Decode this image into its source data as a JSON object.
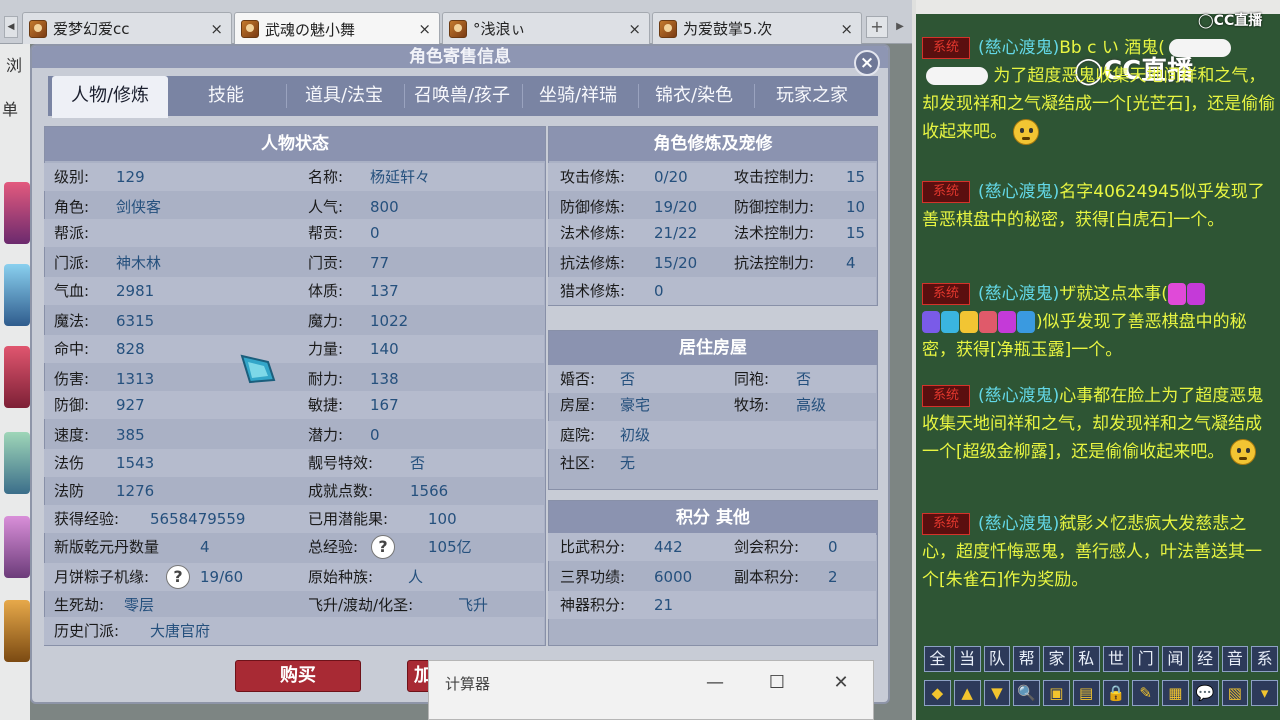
{
  "browser": {
    "tabs": [
      {
        "title": "爱梦幻爱cc",
        "close": "×"
      },
      {
        "title": "武魂の魅小舞",
        "close": "×"
      },
      {
        "title": "°浅浪ぃ",
        "close": "×"
      },
      {
        "title": "为爱鼓掌5.次",
        "close": "×"
      }
    ],
    "new_tab": "+",
    "left_text_1": "浏",
    "left_text_2": "单"
  },
  "dialog": {
    "title": "角色寄售信息",
    "close": "×",
    "tabs": [
      "人物/修炼",
      "技能",
      "道具/法宝",
      "召唤兽/孩子",
      "坐骑/祥瑞",
      "锦衣/染色",
      "玩家之家"
    ],
    "status": {
      "header": "人物状态",
      "left": [
        {
          "label": "级别:",
          "value": "129"
        },
        {
          "label": "角色:",
          "value": "剑侠客"
        },
        {
          "label": "帮派:",
          "value": ""
        },
        {
          "label": "门派:",
          "value": "神木林"
        },
        {
          "label": "气血:",
          "value": "2981"
        },
        {
          "label": "魔法:",
          "value": "6315"
        },
        {
          "label": "命中:",
          "value": "828"
        },
        {
          "label": "伤害:",
          "value": "1313"
        },
        {
          "label": "防御:",
          "value": "927"
        },
        {
          "label": "速度:",
          "value": "385"
        },
        {
          "label": "法伤",
          "value": "1543"
        },
        {
          "label": "法防",
          "value": "1276"
        },
        {
          "label": "获得经验:",
          "value": "5658479559"
        },
        {
          "label": "新版乾元丹数量",
          "value": "4"
        },
        {
          "label": "月饼粽子机缘:",
          "value": "19/60"
        },
        {
          "label": "生死劫:",
          "value": "零层"
        },
        {
          "label": "历史门派:",
          "value": "大唐官府"
        }
      ],
      "right": [
        {
          "label": "名称:",
          "value": "杨延轩々"
        },
        {
          "label": "人气:",
          "value": "800"
        },
        {
          "label": "帮贡:",
          "value": "0"
        },
        {
          "label": "门贡:",
          "value": "77"
        },
        {
          "label": "体质:",
          "value": "137"
        },
        {
          "label": "魔力:",
          "value": "1022"
        },
        {
          "label": "力量:",
          "value": "140"
        },
        {
          "label": "耐力:",
          "value": "138"
        },
        {
          "label": "敏捷:",
          "value": "167"
        },
        {
          "label": "潜力:",
          "value": "0"
        },
        {
          "label": "靓号特效:",
          "value": "否"
        },
        {
          "label": "成就点数:",
          "value": "1566"
        },
        {
          "label": "已用潜能果:",
          "value": "100"
        },
        {
          "label": "总经验:",
          "value": "105亿"
        },
        {
          "label": "原始种族:",
          "value": "人"
        },
        {
          "label": "飞升/渡劫/化圣:",
          "value": "飞升"
        }
      ]
    },
    "cultivation": {
      "header": "角色修炼及宠修",
      "rows": [
        {
          "label": "攻击修炼:",
          "value": "0/20",
          "label2": "攻击控制力:",
          "value2": "15"
        },
        {
          "label": "防御修炼:",
          "value": "19/20",
          "label2": "防御控制力:",
          "value2": "10"
        },
        {
          "label": "法术修炼:",
          "value": "21/22",
          "label2": "法术控制力:",
          "value2": "15"
        },
        {
          "label": "抗法修炼:",
          "value": "15/20",
          "label2": "抗法控制力:",
          "value2": "4"
        },
        {
          "label": "猎术修炼:",
          "value": "0",
          "label2": "",
          "value2": ""
        }
      ]
    },
    "housing": {
      "header": "居住房屋",
      "rows": [
        {
          "label": "婚否:",
          "value": "否",
          "label2": "同袍:",
          "value2": "否"
        },
        {
          "label": "房屋:",
          "value": "豪宅",
          "label2": "牧场:",
          "value2": "高级"
        },
        {
          "label": "庭院:",
          "value": "初级",
          "label2": "",
          "value2": ""
        },
        {
          "label": "社区:",
          "value": "无",
          "label2": "",
          "value2": ""
        }
      ]
    },
    "points": {
      "header": "积分 其他",
      "rows": [
        {
          "label": "比武积分:",
          "value": "442",
          "label2": "剑会积分:",
          "value2": "0"
        },
        {
          "label": "三界功绩:",
          "value": "6000",
          "label2": "副本积分:",
          "value2": "2"
        },
        {
          "label": "神器积分:",
          "value": "21",
          "label2": "",
          "value2": ""
        }
      ]
    },
    "help_icon": "?",
    "buy_label": "购买",
    "buy2_label": "加"
  },
  "calculator": {
    "title": "计算器",
    "minimize": "—",
    "maximize": "☐",
    "close": "✕"
  },
  "chat": {
    "logo_small": "◯CC直播",
    "logo_big": "◯CC直播",
    "sys_tag": "系统",
    "messages": [
      {
        "name": "(慈心渡鬼)",
        "body": "Bb c い 酒鬼(",
        "tail": "为了超度恶鬼收集天地间祥和之气，却发现祥和之气凝结成一个[光芒石]，还是偷偷收起来吧。"
      },
      {
        "name": "(慈心渡鬼)",
        "body": "名字40624945似乎发现了善恶棋盘中的秘密，获得[白虎石]一个。",
        "tail": ""
      },
      {
        "name": "(慈心渡鬼)",
        "body": "ザ就这点本事(",
        "tail": ")似乎发现了善恶棋盘中的秘密，获得[净瓶玉露]一个。"
      },
      {
        "name": "(慈心渡鬼)",
        "body": "心事都在脸上为了超度恶鬼收集天地间祥和之气，却发现祥和之气凝结成一个[超级金柳露]，还是偷偷收起来吧。",
        "tail": ""
      },
      {
        "name": "(慈心渡鬼)",
        "body": "弑影メ忆悲疯大发慈悲之心，超度忏悔恶鬼，善行感人，叶法善送其一个[朱雀石]作为奖励。",
        "tail": ""
      }
    ],
    "channels": [
      "全",
      "当",
      "队",
      "帮",
      "家",
      "私",
      "世",
      "门",
      "闻",
      "经",
      "音",
      "系"
    ],
    "tools": [
      "◆",
      "▲",
      "▼",
      "🔍",
      "▣",
      "▤",
      "🔒",
      "✎",
      "▦",
      "💬",
      "▧",
      "▾"
    ]
  },
  "colors": {
    "dialog_header": "#8b93b0",
    "dialog_tab_bg": "#7a84a3",
    "value_text": "#25507d",
    "chat_bg": "#2e5534",
    "chat_text": "#e8f542",
    "chat_name": "#63d7e6",
    "buy_button": "#a82a34"
  }
}
